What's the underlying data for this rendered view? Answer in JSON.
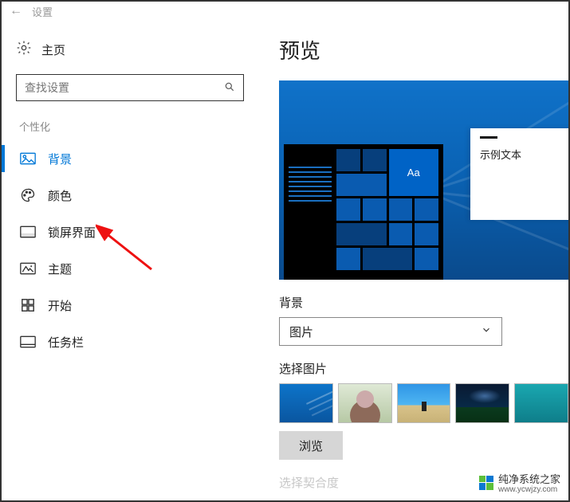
{
  "topbar": {
    "back_glyph": "←",
    "title": "设置"
  },
  "home": {
    "label": "主页"
  },
  "search": {
    "placeholder": "查找设置"
  },
  "category": {
    "label": "个性化"
  },
  "nav": {
    "background": "背景",
    "colors": "颜色",
    "lockscreen": "锁屏界面",
    "themes": "主题",
    "start": "开始",
    "taskbar": "任务栏"
  },
  "main": {
    "preview_heading": "预览",
    "sample_text": "示例文本",
    "tile_aa": "Aa",
    "bg_label": "背景",
    "bg_dropdown_value": "图片",
    "choose_label": "选择图片",
    "browse_label": "浏览",
    "fit_label_partial": "选择契合度"
  },
  "watermark": {
    "brand": "纯净系统之家",
    "url": "www.ycwjzy.com"
  }
}
